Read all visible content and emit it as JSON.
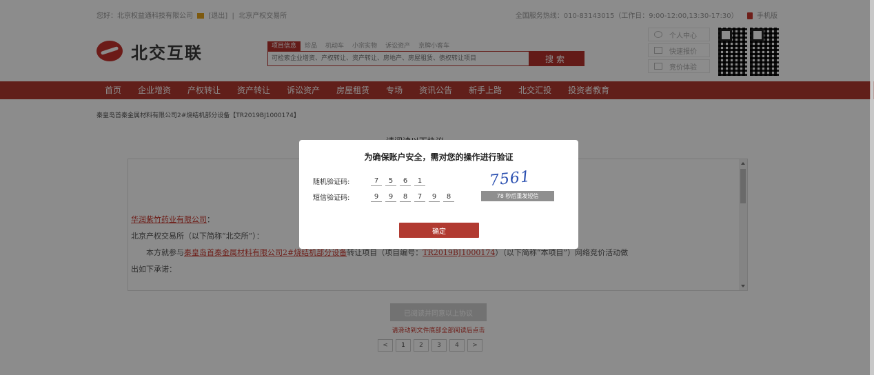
{
  "topbar": {
    "greeting": "您好：北京权益通科技有限公司",
    "logout": "[退出]",
    "site": "北京产权交易所",
    "hotline": "全国服务热线：010-83143015（工作日：9:00-12:00,13:30-17:30）",
    "mobile": "手机版"
  },
  "logo": {
    "text": "北交互联"
  },
  "search": {
    "tabs": [
      "项目信息",
      "珍品",
      "机动车",
      "小宗实物",
      "诉讼资产",
      "京牌小客车"
    ],
    "placeholder": "可检索企业增资、产权转让、资产转让、房地产、房屋租赁、债权转让项目",
    "button": "搜索"
  },
  "quick_links": [
    "个人中心",
    "快速报价",
    "竞价体验"
  ],
  "nav": [
    "首页",
    "企业增资",
    "产权转让",
    "资产转让",
    "诉讼资产",
    "房屋租赁",
    "专场",
    "资讯公告",
    "新手上路",
    "北交汇投",
    "投资者教育"
  ],
  "breadcrumb": "秦皇岛首秦金属材料有限公司2#烧结机部分设备【TR2019BJ1000174】",
  "content": {
    "title": "请阅读以下协议",
    "company": "华润紫竹药业有限公司",
    "colon": "：",
    "line2": "北京产权交易所（以下简称“北交所”）：",
    "line3_a": "本方就参与",
    "line3_link1": "秦皇岛首秦金属材料有限公司2#烧结机部分设备",
    "line3_b": "转让项目（项目编号：",
    "line3_link2": "TR2019BJ1000174",
    "line3_c": "）（以下简称“本项目”）网络竞价活动做",
    "line4": "出如下承诺："
  },
  "agree_button": "已阅读并同意以上协议",
  "agree_hint": "请滑动到文件底部全部阅读后点击",
  "pager": [
    "<",
    "1",
    "2",
    "3",
    "4",
    ">"
  ],
  "modal": {
    "title": "为确保账户安全，需对您的操作进行验证",
    "random_label": "随机验证码:",
    "random_digits": [
      "7",
      "5",
      "6",
      "1"
    ],
    "sms_label": "短信验证码:",
    "sms_digits": [
      "9",
      "9",
      "8",
      "7",
      "9",
      "8"
    ],
    "captcha_image_text": "7561",
    "resend": "78 秒后重发短信",
    "confirm": "确定"
  },
  "colors": {
    "brand_red": "#b13a31",
    "captcha_blue": "#2a4fb0"
  }
}
